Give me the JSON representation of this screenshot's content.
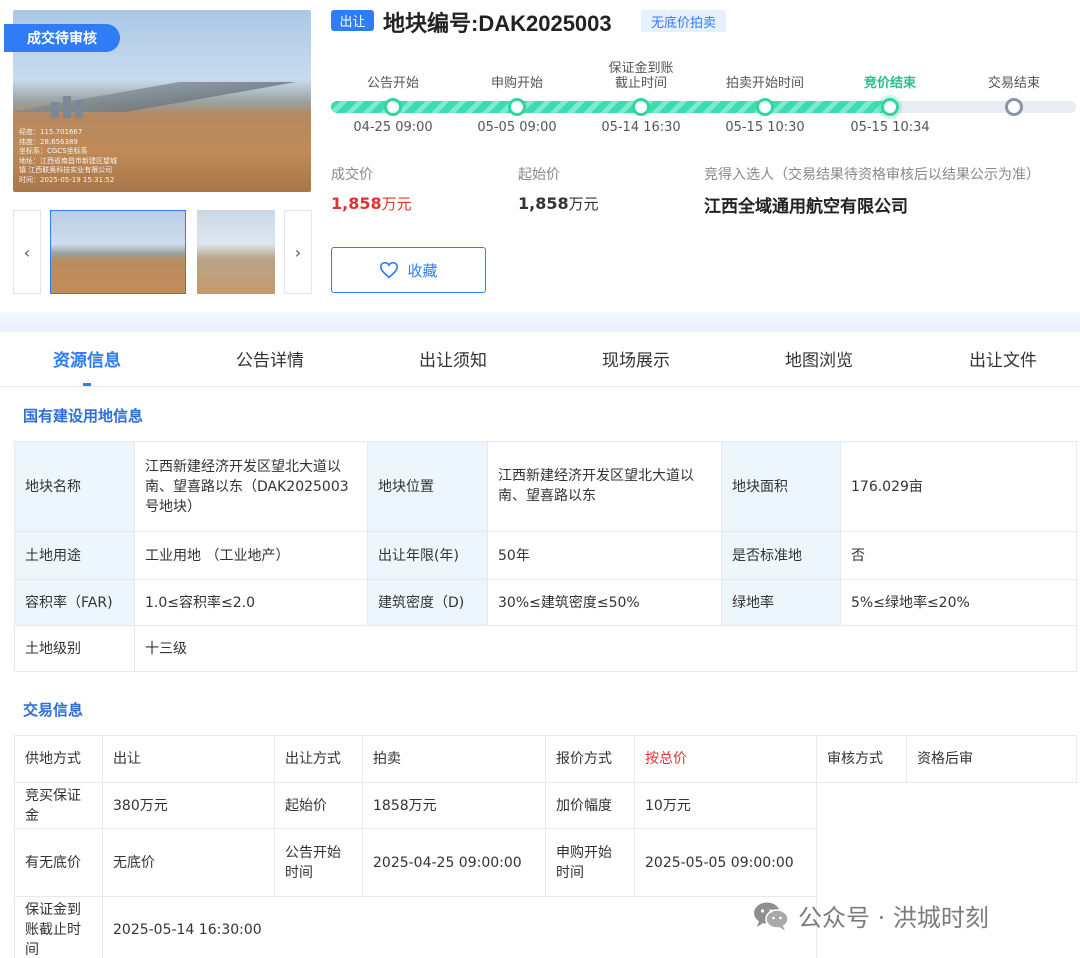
{
  "gallery": {
    "status_ribbon": "成交待审核",
    "photo_overlay": [
      "经度：115.701667",
      "纬度：28.656389",
      "坐标系：CGCS坐标系",
      "地址：江西省南昌市新建区望城",
      "镇 江西联奥科技实业有限公司",
      "时间：2025-05-19 15:31:52"
    ],
    "prev_label": "‹",
    "next_label": "›"
  },
  "header": {
    "transfer_tag": "出让",
    "parcel_title": "地块编号:DAK2025003",
    "noreserve_tag": "无底价拍卖"
  },
  "timeline": {
    "progress_fraction": 0.75,
    "steps": [
      {
        "label": "公告开始",
        "time": "04-25 09:00",
        "state": "done"
      },
      {
        "label": "申购开始",
        "time": "05-05 09:00",
        "state": "done"
      },
      {
        "label": "保证金到账\n截止时间",
        "time": "05-14 16:30",
        "state": "done"
      },
      {
        "label": "拍卖开始时间",
        "time": "05-15 10:30",
        "state": "done"
      },
      {
        "label": "竞价结束",
        "time": "05-15 10:34",
        "state": "current"
      },
      {
        "label": "交易结束",
        "time": "",
        "state": "pending"
      }
    ]
  },
  "prices": {
    "deal_caption": "成交价",
    "deal_value": "1,858",
    "deal_unit": "万元",
    "start_caption": "起始价",
    "start_value": "1,858",
    "start_unit": "万元",
    "winner_caption": "竞得入选人（交易结果待资格审核后以结果公示为准）",
    "winner_name": "江西全域通用航空有限公司"
  },
  "favorite_label": "收藏",
  "tabs": [
    "资源信息",
    "公告详情",
    "出让须知",
    "现场展示",
    "地图浏览",
    "出让文件"
  ],
  "land_info": {
    "title": "国有建设用地信息",
    "rows": [
      [
        "地块名称",
        "江西新建经济开发区望北大道以南、望喜路以东（DAK2025003号地块）",
        "地块位置",
        "江西新建经济开发区望北大道以南、望喜路以东",
        "地块面积",
        "176.029亩"
      ],
      [
        "土地用途",
        "工业用地 （工业地产）",
        "出让年限(年)",
        "50年",
        "是否标准地",
        "否"
      ],
      [
        "容积率（FAR)",
        "1.0≤容积率≤2.0",
        "建筑密度（D)",
        "30%≤建筑密度≤50%",
        "绿地率",
        "5%≤绿地率≤20%"
      ],
      [
        "土地级别",
        "十三级"
      ]
    ]
  },
  "trade_info": {
    "title": "交易信息",
    "rows": [
      [
        "供地方式",
        "出让",
        "出让方式",
        "拍卖",
        "报价方式",
        "按总价",
        "审核方式",
        "资格后审"
      ],
      [
        "竞买保证金",
        "380万元",
        "起始价",
        "1858万元",
        "加价幅度",
        "10万元"
      ],
      [
        "有无底价",
        "无底价",
        "公告开始时间",
        "2025-04-25 09:00:00",
        "申购开始时间",
        "2025-05-05 09:00:00"
      ],
      [
        "保证金到账截止时间",
        "2025-05-14 16:30:00"
      ]
    ]
  },
  "watermark": "公众号 · 洪城时刻",
  "colors": {
    "accent": "#2f7cf6",
    "progress": "#2fd6a4",
    "price_red": "#e0332e",
    "label_bg": "#eef6fd"
  }
}
